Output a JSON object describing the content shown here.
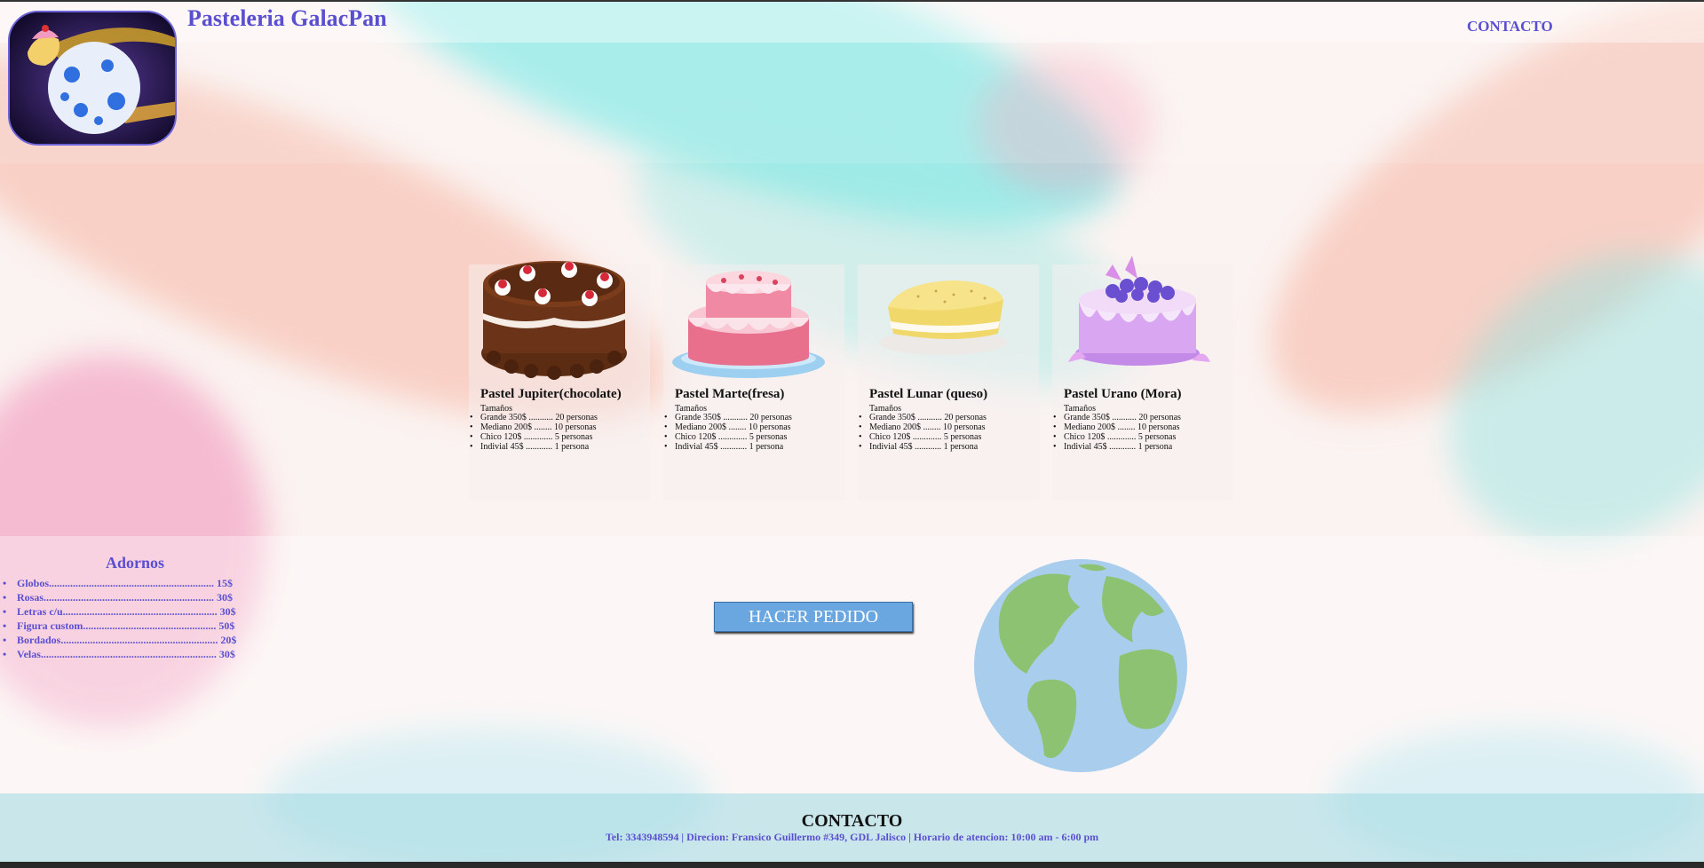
{
  "header": {
    "brand": "Pasteleria GalacPan",
    "nav_contact": "CONTACTO"
  },
  "cakes": [
    {
      "name": "Pastel Jupiter(chocolate)",
      "sizes_label": "Tamaños",
      "sizes": [
        "Grande 350$ ........... 20 personas",
        "Mediano 200$ ........ 10 personas",
        "Chico 120$ ............. 5 personas",
        "Indivial 45$ ............ 1 persona"
      ]
    },
    {
      "name": "Pastel Marte(fresa)",
      "sizes_label": "Tamaños",
      "sizes": [
        "Grande 350$ ........... 20 personas",
        "Mediano 200$ ........ 10 personas",
        "Chico 120$ ............. 5 personas",
        "Indivial 45$ ............ 1 persona"
      ]
    },
    {
      "name": "Pastel Lunar (queso)",
      "sizes_label": "Tamaños",
      "sizes": [
        "Grande 350$ ........... 20 personas",
        "Mediano 200$ ........ 10 personas",
        "Chico 120$ ............. 5 personas",
        "Indivial 45$ ............ 1 persona"
      ]
    },
    {
      "name": "Pastel Urano (Mora)",
      "sizes_label": "Tamaños",
      "sizes": [
        "Grande 350$ ........... 20 personas",
        "Mediano 200$ ........ 10 personas",
        "Chico 120$ ............. 5 personas",
        "Indivial 45$ ............ 1 persona"
      ]
    }
  ],
  "adornos": {
    "title": "Adornos",
    "items": [
      "Globos.............................................................. 15$",
      "Rosas................................................................ 30$",
      "Letras c/u.......................................................... 30$",
      "Figura custom.................................................. 50$",
      "Bordados........................................................... 20$",
      "Velas.................................................................. 30$"
    ]
  },
  "order_button": "HACER PEDIDO",
  "footer": {
    "title": "CONTACTO",
    "info": "Tel: 3343948594 | Direcion: Fransico Guillermo #349, GDL Jalisco | Horario de atencion: 10:00 am - 6:00 pm"
  },
  "colors": {
    "accent": "#5b4fd1",
    "button": "#6aa7e0",
    "footer": "#b4e1e8"
  }
}
